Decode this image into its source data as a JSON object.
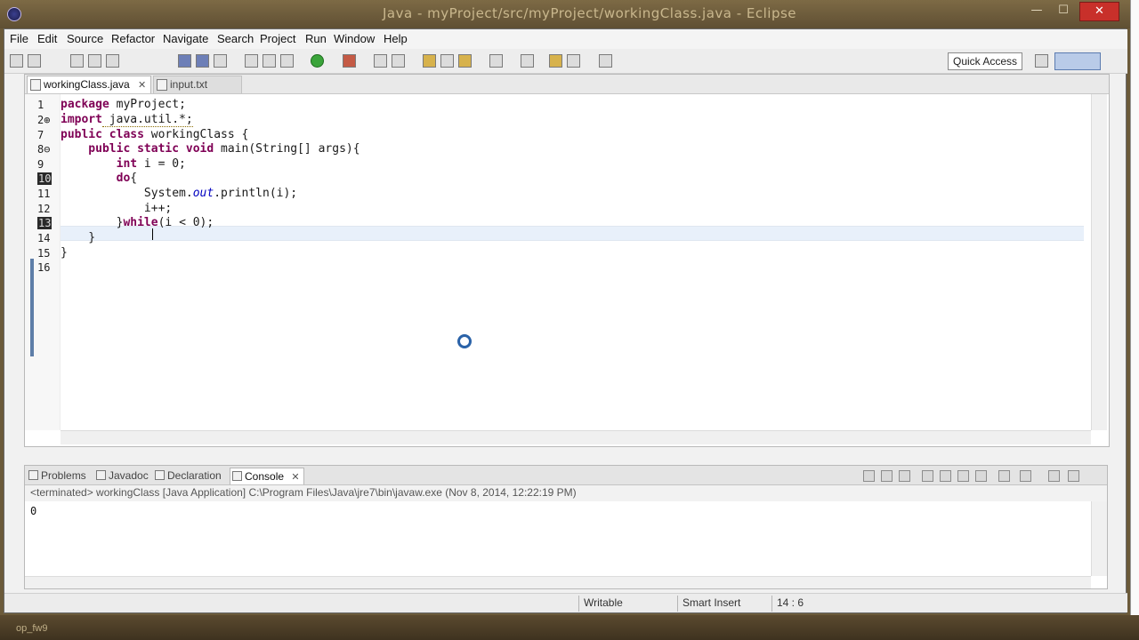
{
  "titlebar": {
    "title": "Java - myProject/src/myProject/workingClass.java - Eclipse",
    "minimize": "—",
    "maximize": "☐",
    "close": "✕"
  },
  "menu": {
    "items": [
      "File",
      "Edit",
      "Source",
      "Refactor",
      "Navigate",
      "Search",
      "Project",
      "Run",
      "Window",
      "Help"
    ]
  },
  "toolbar": {
    "quick_access": "Quick Access"
  },
  "editor": {
    "tabs": [
      {
        "label": "workingClass.java",
        "close": "✕"
      },
      {
        "label": "input.txt"
      }
    ],
    "line_numbers": [
      "1",
      "2⊕",
      "7",
      "8⊖",
      "9",
      "10",
      "11",
      "12",
      "13",
      "14",
      "15",
      "16"
    ],
    "code": {
      "l1_kw": "package",
      "l1_rest": " myProject;",
      "l2_kw": "import",
      "l2_rest": " java.util.*;",
      "l3_kw": "public class",
      "l3_rest": " workingClass {",
      "l4_kw": "    public static void",
      "l4_rest": " main(String[] args){",
      "l5_kw": "        int",
      "l5_rest": " i = 0;",
      "l6_kw": "        do",
      "l6_rest": "{",
      "l7_a": "            System.",
      "l7_fld": "out",
      "l7_b": ".println(i);",
      "l8": "            i++;",
      "l9_a": "        }",
      "l9_kw": "while",
      "l9_b": "(i < 0);",
      "l10": "    }",
      "l11": "}",
      "l12": ""
    }
  },
  "console": {
    "tabs": [
      "Problems",
      "Javadoc",
      "Declaration",
      "Console"
    ],
    "close": "✕",
    "header": "<terminated> workingClass [Java Application] C:\\Program Files\\Java\\jre7\\bin\\javaw.exe (Nov 8, 2014, 12:22:19 PM)",
    "output": "0"
  },
  "status": {
    "writable": "Writable",
    "insert_mode": "Smart Insert",
    "position": "14 : 6"
  },
  "taskbar": {
    "item": "op_fw9"
  }
}
